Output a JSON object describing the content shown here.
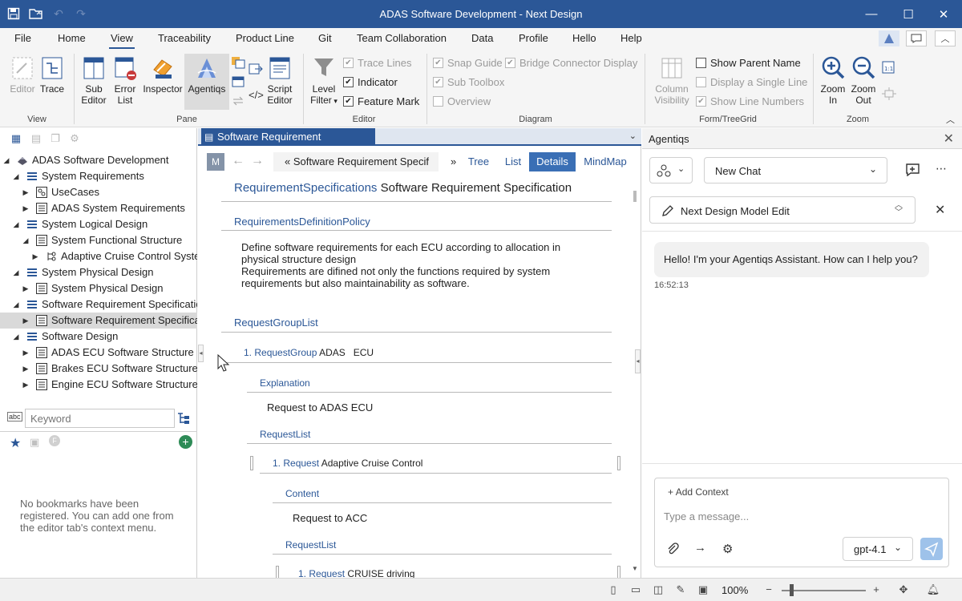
{
  "window": {
    "title": "ADAS Software Development - Next Design"
  },
  "menu": [
    "File",
    "Home",
    "View",
    "Traceability",
    "Product Line",
    "Git",
    "Team Collaboration",
    "Data",
    "Profile",
    "Hello",
    "Help"
  ],
  "ribbon": {
    "view_group": {
      "label": "View",
      "editor": "Editor",
      "trace": "Trace"
    },
    "pane_group": {
      "label": "Pane",
      "sub_editor": [
        "Sub",
        "Editor"
      ],
      "error_list": [
        "Error",
        "List"
      ],
      "inspector": "Inspector",
      "agentiqs": "Agentiqs",
      "script_editor": [
        "Script",
        "Editor"
      ]
    },
    "editor_group": {
      "label": "Editor",
      "level_filter": [
        "Level",
        "Filter"
      ],
      "trace_lines": "Trace Lines",
      "indicator": "Indicator",
      "feature_mark": "Feature Mark"
    },
    "diagram_group": {
      "label": "Diagram",
      "snap_guide": "Snap Guide",
      "bridge_connector": "Bridge Connector Display",
      "sub_toolbox": "Sub Toolbox",
      "overview": "Overview"
    },
    "formtree_group": {
      "label": "Form/TreeGrid",
      "column_visibility": [
        "Column",
        "Visibility"
      ],
      "show_parent_name": "Show Parent Name",
      "display_single_line": "Display a Single Line",
      "show_line_numbers": "Show Line Numbers"
    },
    "zoom_group": {
      "label": "Zoom",
      "zoom_in": [
        "Zoom",
        "In"
      ],
      "zoom_out": [
        "Zoom",
        "Out"
      ]
    }
  },
  "tree": {
    "root": "ADAS Software Development",
    "items": [
      {
        "label": "System Requirements",
        "level": 1,
        "exp": "down",
        "icon": "list"
      },
      {
        "label": "UseCases",
        "level": 2,
        "exp": "right",
        "icon": "usecase"
      },
      {
        "label": "ADAS System Requirements",
        "level": 2,
        "exp": "right",
        "icon": "grid"
      },
      {
        "label": "System Logical Design",
        "level": 1,
        "exp": "down",
        "icon": "list"
      },
      {
        "label": "System Functional Structure",
        "level": 2,
        "exp": "down",
        "icon": "grid"
      },
      {
        "label": "Adaptive Cruise Control System",
        "level": 3,
        "exp": "right",
        "icon": "tree"
      },
      {
        "label": "System Physical Design",
        "level": 1,
        "exp": "down",
        "icon": "list"
      },
      {
        "label": "System Physical Design",
        "level": 2,
        "exp": "right",
        "icon": "grid"
      },
      {
        "label": "Software Requirement Specification",
        "level": 1,
        "exp": "down",
        "icon": "list"
      },
      {
        "label": "Software Requirement Specification",
        "level": 2,
        "exp": "right",
        "icon": "grid",
        "selected": true
      },
      {
        "label": "Software Design",
        "level": 1,
        "exp": "down",
        "icon": "list"
      },
      {
        "label": "ADAS ECU Software Structure",
        "level": 2,
        "exp": "right",
        "icon": "grid"
      },
      {
        "label": "Brakes ECU Software Structure",
        "level": 2,
        "exp": "right",
        "icon": "grid"
      },
      {
        "label": "Engine ECU Software Structure",
        "level": 2,
        "exp": "right",
        "icon": "grid"
      }
    ]
  },
  "search": {
    "placeholder": "Keyword"
  },
  "bookmarks": {
    "hint": "No bookmarks have been registered. You can add one from the editor tab's context menu."
  },
  "editor": {
    "tab": "Software Requirement Specification",
    "nav": {
      "m": "M",
      "breadcrumb_prev": "«",
      "breadcrumb": "Software Requirement Specif",
      "breadcrumb_next": "»",
      "tree": "Tree",
      "list": "List",
      "details": "Details",
      "mindmap": "MindMap"
    },
    "title_class": "RequirementSpecifications",
    "title": "Software Requirement Specification",
    "policy_label": "RequirementsDefinitionPolicy",
    "policy_lines": [
      "Define software requirements for each ECU according to allocation in",
      "physical structure design",
      "Requirements are difined not only the functions required by system",
      "requirements but also maintainability as software."
    ],
    "group_list_label": "RequestGroupList",
    "group_item": {
      "num": "1.",
      "cls": "RequestGroup",
      "name": "ADAS   ECU"
    },
    "explanation_label": "Explanation",
    "explanation": "Request to ADAS ECU",
    "request_list_label": "RequestList",
    "request_item": {
      "num": "1.",
      "cls": "Request",
      "name": "Adaptive Cruise Control"
    },
    "content_label": "Content",
    "content": "Request to ACC",
    "request_list2_label": "RequestList",
    "request_item2": {
      "num": "1.",
      "cls": "Request",
      "name": "CRUISE driving"
    }
  },
  "chat": {
    "title": "Agentiqs",
    "new_chat": "New Chat",
    "mode": "Next Design Model Edit",
    "greeting": "Hello! I'm your Agentiqs Assistant. How can I help you?",
    "time": "16:52:13",
    "add_context": "Add Context",
    "input_placeholder": "Type a message...",
    "model": "gpt-4.1"
  },
  "status": {
    "zoom": "100%"
  },
  "colors": {
    "accent": "#2b5797",
    "titlebar": "#2b5797"
  }
}
